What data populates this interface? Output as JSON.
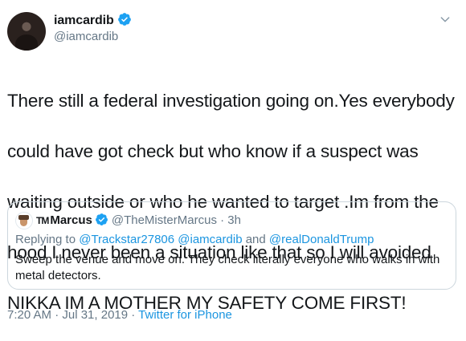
{
  "author": {
    "display_name": "iamcardib",
    "handle": "@iamcardib",
    "verified": true
  },
  "tweet": {
    "lines": [
      "There still  a federal investigation going on.Yes everybody",
      "could have got check but who know if a suspect was",
      "waiting outside or who he wanted to target .Im from the",
      "hood I never been a situation like that so I will avoided",
      "NIKKA IM A MOTHER MY SAFETY COME FIRST!"
    ]
  },
  "quoted": {
    "name_prefix": "TM",
    "name": "Marcus",
    "handle": "@TheMisterMarcus",
    "separator": " · ",
    "time": "3h",
    "reply_prefix": "Replying to ",
    "reply_users": [
      "@Trackstar27806",
      "@iamcardib",
      "@realDonaldTrump"
    ],
    "reply_joiner": " and ",
    "text": "Sweep the venue and move on. They check literally everyone who walks in with metal detectors."
  },
  "footer": {
    "timestamp": "7:20 AM · Jul 31, 2019",
    "separator": " · ",
    "source": "Twitter for iPhone"
  },
  "colors": {
    "link": "#1b95e0",
    "muted": "#657786",
    "verified": "#1da1f2",
    "border": "#ccd6dd"
  },
  "icons": {
    "verified": "verified-badge-icon",
    "caret": "chevron-down-icon"
  }
}
